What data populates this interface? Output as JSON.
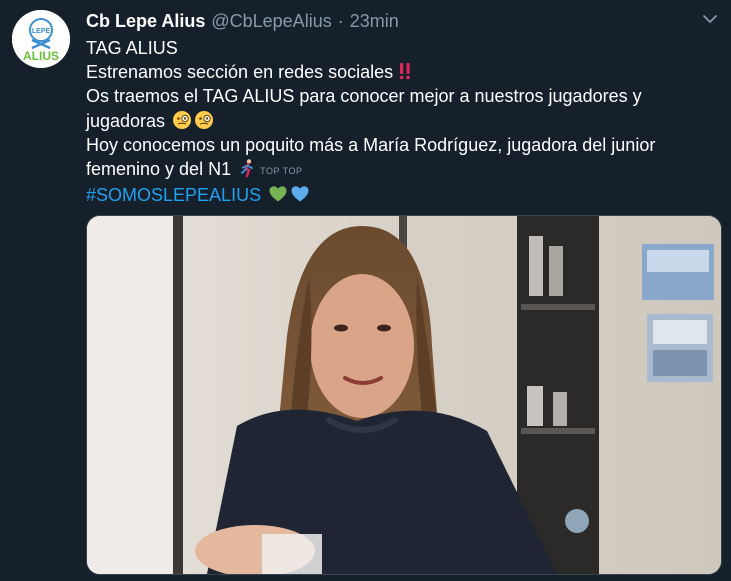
{
  "account": {
    "display_name": "Cb Lepe Alius",
    "handle": "@CbLepeAlius",
    "separator": "·",
    "time": "23min",
    "avatar_logo_text": "ALIUS",
    "avatar_logo_small": "LEPE"
  },
  "tweet": {
    "line1": "TAG ALIUS",
    "line2": "Estrenamos sección en redes sociales",
    "line3": "Os traemos el TAG ALIUS para conocer mejor a nuestros jugadores y",
    "line4": "jugadoras",
    "line5": "Hoy conocemos un poquito más a María Rodríguez, jugadora del junior",
    "line6": "femenino y del N1",
    "sticker_text": "TOP TOP",
    "hashtag": "#SOMOSLEPEALIUS"
  },
  "emoji": {
    "line2": "double-exclamation-icon",
    "line4": [
      "face-with-monocle-icon",
      "face-with-monocle-icon"
    ],
    "line6": "person-running-icon",
    "line7": [
      "green-heart-icon",
      "blue-heart-icon"
    ]
  },
  "media": {
    "type": "video-thumbnail",
    "description_hidden": ""
  },
  "colors": {
    "background": "#15202b",
    "text": "#ffffff",
    "muted": "#8899a6",
    "link": "#1da1f2",
    "logo_green": "#6abf3c",
    "logo_blue": "#3d8fd1"
  }
}
